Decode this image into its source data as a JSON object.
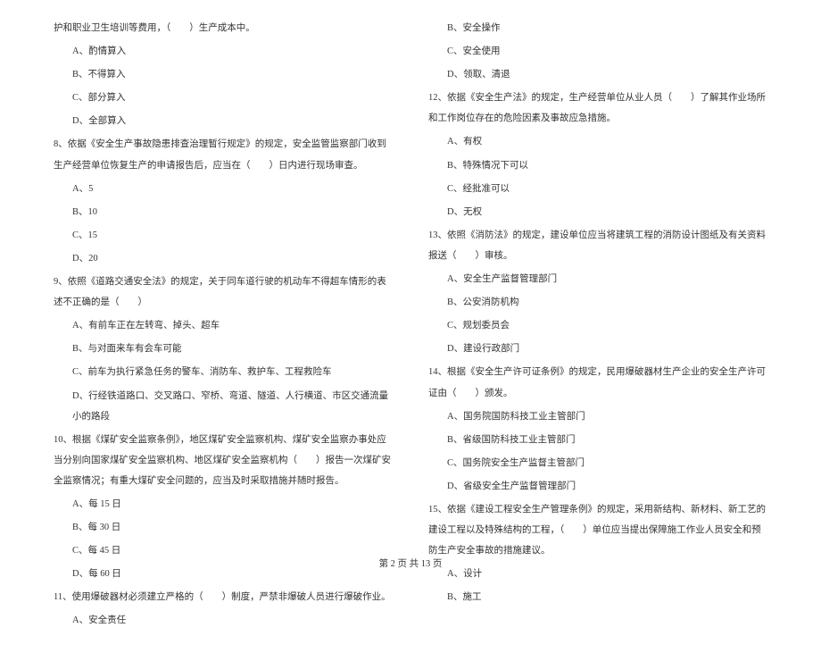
{
  "left_column": {
    "q7_tail": "护和职业卫生培训等费用，（　　）生产成本中。",
    "q7_options": [
      "A、酌情算入",
      "B、不得算入",
      "C、部分算入",
      "D、全部算入"
    ],
    "q8": "8、依据《安全生产事故隐患排查治理暂行规定》的规定，安全监管监察部门收到生产经营单位恢复生产的申请报告后，应当在（　　）日内进行现场审查。",
    "q8_options": [
      "A、5",
      "B、10",
      "C、15",
      "D、20"
    ],
    "q9": "9、依照《道路交通安全法》的规定，关于同车道行驶的机动车不得超车情形的表述不正确的是（　　）",
    "q9_options": [
      "A、有前车正在左转弯、掉头、超车",
      "B、与对面来车有会车可能",
      "C、前车为执行紧急任务的警车、消防车、救护车、工程救险车",
      "D、行经铁道路口、交叉路口、窄桥、弯道、隧道、人行横道、市区交通流量小的路段"
    ],
    "q10": "10、根据《煤矿安全监察条例》，地区煤矿安全监察机构、煤矿安全监察办事处应当分别向国家煤矿安全监察机构、地区煤矿安全监察机构（　　）报告一次煤矿安全监察情况；有重大煤矿安全问题的，应当及时采取措施并随时报告。",
    "q10_options": [
      "A、每 15 日",
      "B、每 30 日",
      "C、每 45 日",
      "D、每 60 日"
    ],
    "q11": "11、使用爆破器材必须建立严格的（　　）制度，严禁非爆破人员进行爆破作业。",
    "q11_options": [
      "A、安全责任"
    ]
  },
  "right_column": {
    "q11_options_cont": [
      "B、安全操作",
      "C、安全使用",
      "D、领取、清退"
    ],
    "q12": "12、依据《安全生产法》的规定，生产经营单位从业人员（　　）了解其作业场所和工作岗位存在的危险因素及事故应急措施。",
    "q12_options": [
      "A、有权",
      "B、特殊情况下可以",
      "C、经批准可以",
      "D、无权"
    ],
    "q13": "13、依照《消防法》的规定，建设单位应当将建筑工程的消防设计图纸及有关资料报送（　　）审核。",
    "q13_options": [
      "A、安全生产监督管理部门",
      "B、公安消防机构",
      "C、规划委员会",
      "D、建设行政部门"
    ],
    "q14": "14、根据《安全生产许可证条例》的规定，民用爆破器材生产企业的安全生产许可证由（　　）颁发。",
    "q14_options": [
      "A、国务院国防科技工业主管部门",
      "B、省级国防科技工业主管部门",
      "C、国务院安全生产监督主管部门",
      "D、省级安全生产监督管理部门"
    ],
    "q15": "15、依据《建设工程安全生产管理条例》的规定，采用新结构、新材料、新工艺的建设工程以及特殊结构的工程，（　　）单位应当提出保障施工作业人员安全和预防生产安全事故的措施建议。",
    "q15_options": [
      "A、设计",
      "B、施工"
    ]
  },
  "footer": "第 2 页 共 13 页"
}
